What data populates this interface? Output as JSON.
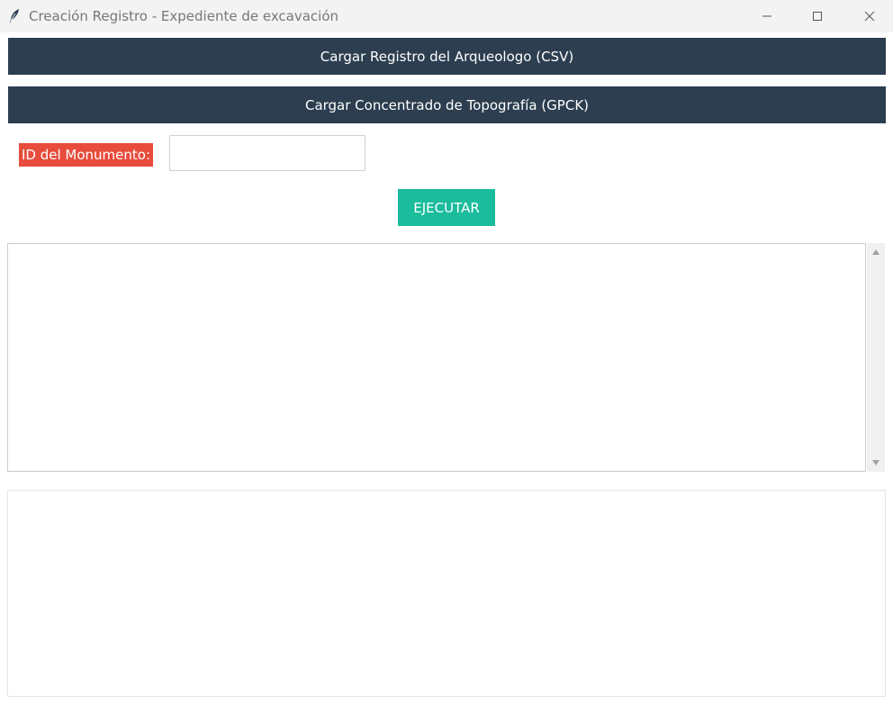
{
  "window": {
    "title": "Creación Registro - Expediente de excavación",
    "icon": "feather-icon",
    "controls": [
      "minimize-icon",
      "maximize-icon",
      "close-icon"
    ]
  },
  "buttons": {
    "load_csv": "Cargar Registro del Arqueologo (CSV)",
    "load_gpck": "Cargar Concentrado de Topografía (GPCK)",
    "run": "EJECUTAR"
  },
  "form": {
    "id_label": "ID del Monumento:",
    "id_value": ""
  },
  "log": {
    "text": ""
  },
  "colors": {
    "bar_button": "#2c3e50",
    "label_bg": "#e74c3c",
    "run_button": "#1abc9c"
  }
}
